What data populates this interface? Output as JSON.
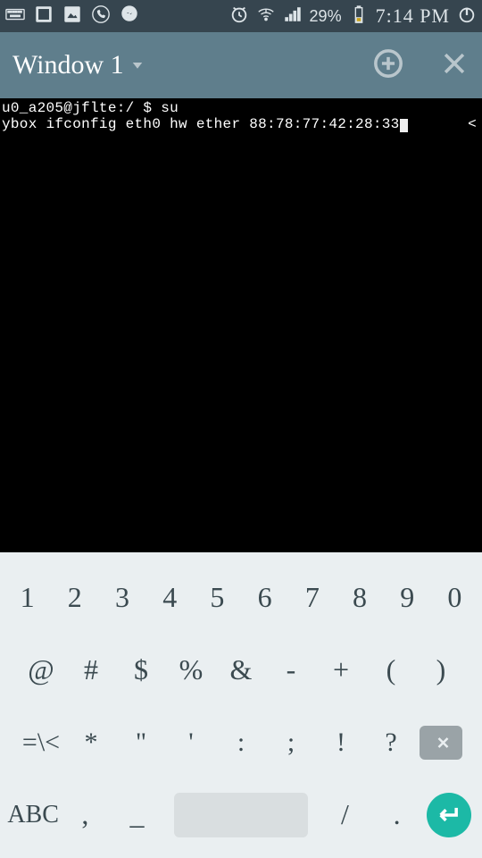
{
  "status": {
    "battery_pct": "29%",
    "time": "7:14 PM"
  },
  "appbar": {
    "window_title": "Window 1"
  },
  "terminal": {
    "line1": "u0_a205@jflte:/ $ su",
    "line2": "ybox ifconfig eth0 hw ether 88:78:77:42:28:33",
    "scroll_indicator": "<"
  },
  "keyboard": {
    "row1": [
      "1",
      "2",
      "3",
      "4",
      "5",
      "6",
      "7",
      "8",
      "9",
      "0"
    ],
    "row2": [
      "@",
      "#",
      "$",
      "%",
      "&",
      "-",
      "+",
      "(",
      ")"
    ],
    "row3_mode": "=\\<",
    "row3": [
      "*",
      "\"",
      "'",
      ":",
      ";",
      "!",
      "?"
    ],
    "row4_abc": "ABC",
    "row4": [
      ",",
      "_",
      "/",
      "."
    ]
  }
}
